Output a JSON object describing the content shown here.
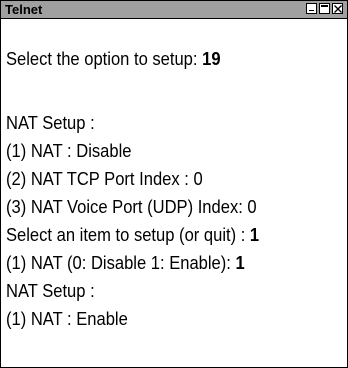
{
  "window": {
    "title": "Telnet",
    "controls": [
      "minimize-icon",
      "maximize-icon",
      "close-icon"
    ]
  },
  "terminal": {
    "prompt1": {
      "text": "Select the option to setup: ",
      "answer": "19"
    },
    "section1_header": "NAT Setup :",
    "option1": "(1) NAT : Disable",
    "option2": "(2) NAT TCP Port Index : 0",
    "option3": "(3) NAT Voice Port (UDP) Index: 0",
    "prompt2": {
      "text": "Select an item to setup (or quit) : ",
      "answer": "1"
    },
    "prompt3": {
      "text": "(1) NAT (0: Disable 1: Enable): ",
      "answer": "1"
    },
    "section2_header": "NAT Setup :",
    "result": "(1) NAT : Enable"
  }
}
